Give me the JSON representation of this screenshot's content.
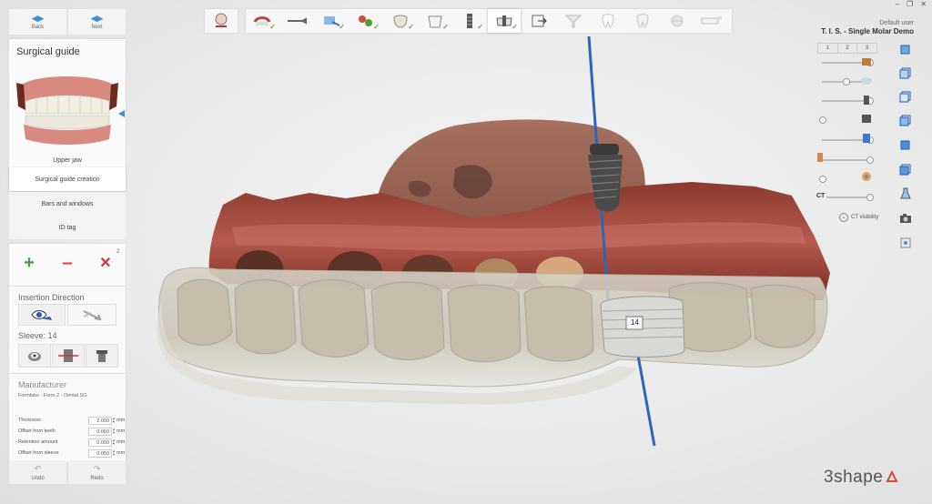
{
  "window": {
    "minimize_label": "–",
    "restore_label": "❐",
    "close_label": "✕"
  },
  "user": {
    "name": "Default user",
    "project": "T. I. S. - Single Molar Demo"
  },
  "nav": {
    "back_label": "Back",
    "next_label": "Next"
  },
  "panel": {
    "title": "Surgical guide",
    "jaw_label": "Upper jaw"
  },
  "menu": [
    {
      "label": "Surgical guide creation"
    },
    {
      "label": "Bars and windows"
    },
    {
      "label": "ID tag"
    }
  ],
  "tools": {
    "add": "+",
    "remove": "–",
    "delete": "✕",
    "badge": "2"
  },
  "insertion": {
    "title": "Insertion Direction"
  },
  "sleeve": {
    "title": "Sleeve: 14"
  },
  "manufacturer": {
    "title": "Manufacturer",
    "name": "Formlabs - Form 2 - Dental SG"
  },
  "params": [
    {
      "label": "Thickness",
      "value": "2.000",
      "unit": "mm"
    },
    {
      "label": "Offset from teeth",
      "value": "0.060",
      "unit": "mm"
    },
    {
      "label": "Retention amount",
      "value": "0.000",
      "unit": "mm"
    },
    {
      "label": "Offset from sleeve",
      "value": "0.050",
      "unit": "mm"
    }
  ],
  "history": {
    "undo_label": "Undo",
    "redo_label": "Redo"
  },
  "viewport": {
    "sleeve_tag": "14"
  },
  "visibility": {
    "tabs": [
      "1",
      "2",
      "3"
    ],
    "ct_label": "CT",
    "ct_visibility_label": "CT visibility",
    "sliders": [
      1.0,
      0.5,
      1.0,
      0.0,
      1.0,
      1.0,
      0.0,
      1.0
    ]
  },
  "logo": {
    "text": "3shape"
  },
  "colors": {
    "accent": "#3a8fd6",
    "check": "#6aa82b",
    "add": "#3aa43a",
    "remove": "#e23b3b"
  }
}
